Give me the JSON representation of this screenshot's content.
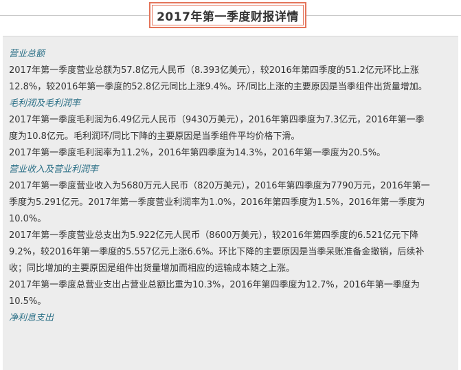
{
  "title": "2017年第一季度财报详情",
  "sections": [
    {
      "heading": "营业总额",
      "paras": [
        [
          "2017年第一季度营业总额为57.8亿元人民币（8.393亿美元），较2016年第四季度的51.2亿元环比上涨",
          "12.8%，较2016年第一季度的52.8亿元同比上涨9.4%。环/同比上涨的主要原因是当季组件出货量增加。"
        ]
      ]
    },
    {
      "heading": "毛利润及毛利润率",
      "paras": [
        [
          "2017年第一季度毛利润为6.49亿元人民币（9430万美元），2016年第四季度为7.3亿元，2016年第一季",
          "度为10.8亿元。毛利润环/同比下降的主要原因是当季组件平均价格下滑。"
        ],
        [
          "2017年第一季度毛利润率为11.2%，2016年第四季度为14.3%，2016年第一季度为20.5%。"
        ]
      ]
    },
    {
      "heading": "营业收入及营业利润率",
      "paras": [
        [
          "2017年第一季度营业收入为5680万元人民币（820万美元），2016年第四季度为7790万元，2016年第一",
          "季度为5.291亿元。2017年第一季度营业利润率为1.0%，2016年第四季度为1.5%，2016年第一季度为",
          "10.0%。"
        ],
        [
          "2017年第一季度营业总支出为5.922亿元人民币（8600万美元），较2016年第四季度的6.521亿元下降",
          "9.2%，较2016年第一季度的5.557亿元上涨6.6%。环比下降的主要原因是当季呆账准备金撤销，后续补",
          "收；同比增加的主要原因是组件出货量增加而相应的运输成本随之上涨。"
        ],
        [
          "2017年第一季度总营业支出占营业总额比重为10.3%，2016年第四季度为12.7%，2016年第一季度为",
          "10.5%。"
        ]
      ]
    },
    {
      "heading": "净利息支出",
      "paras": []
    }
  ]
}
